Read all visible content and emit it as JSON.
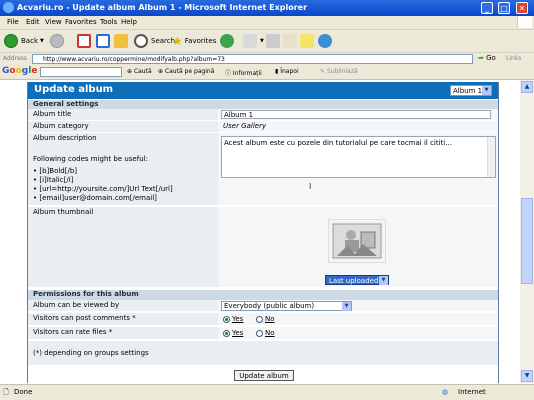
{
  "window": {
    "title": "Acvariu.ro - Update album Album 1 - Microsoft Internet Explorer"
  },
  "menu": [
    "File",
    "Edit",
    "View",
    "Favorites",
    "Tools",
    "Help"
  ],
  "toolbar": {
    "back": "Back",
    "search": "Search",
    "favorites": "Favorites"
  },
  "address": {
    "label": "Address",
    "url": "http://www.acvariu.ro/coppermine/modifyalb.php?album=73",
    "go": "Go",
    "links": "Links"
  },
  "google": {
    "logo": "Google",
    "search_label": "Caută",
    "search_page": "Caută pe pagină",
    "info": "Informații",
    "back": "Înapoi",
    "highlight": "Subliniază"
  },
  "page": {
    "header": "Update album",
    "album_select": "Album 1",
    "general_settings": "General settings",
    "album_title_label": "Album title",
    "album_title_value": "Album 1",
    "album_category_label": "Album category",
    "album_category_value": "User Gallery",
    "album_description_label": "Album description",
    "album_description_value": "Acest album este cu pozele din tutorialul pe care tocmai il cititi...",
    "codes_intro": "Following codes might be useful:",
    "codes": [
      "[b]Bold[/b]",
      "[i]Italic[/i]",
      "[url=http://yoursite.com/]Url Text[/url]",
      "[email]user@domain.com[/email]"
    ],
    "thumbnail_label": "Album thumbnail",
    "thumbnail_select": "Last uploaded",
    "permissions_title": "Permissions for this album",
    "viewed_by_label": "Album can be viewed by",
    "viewed_by_value": "Everybody (public album)",
    "comments_label": "Visitors can post comments *",
    "rate_label": "Visitors can rate files *",
    "yes": "Yes",
    "no": "No",
    "footnote": "(*) depending on groups settings",
    "submit": "Update album"
  },
  "status": {
    "left": "Done",
    "zone": "Internet"
  }
}
